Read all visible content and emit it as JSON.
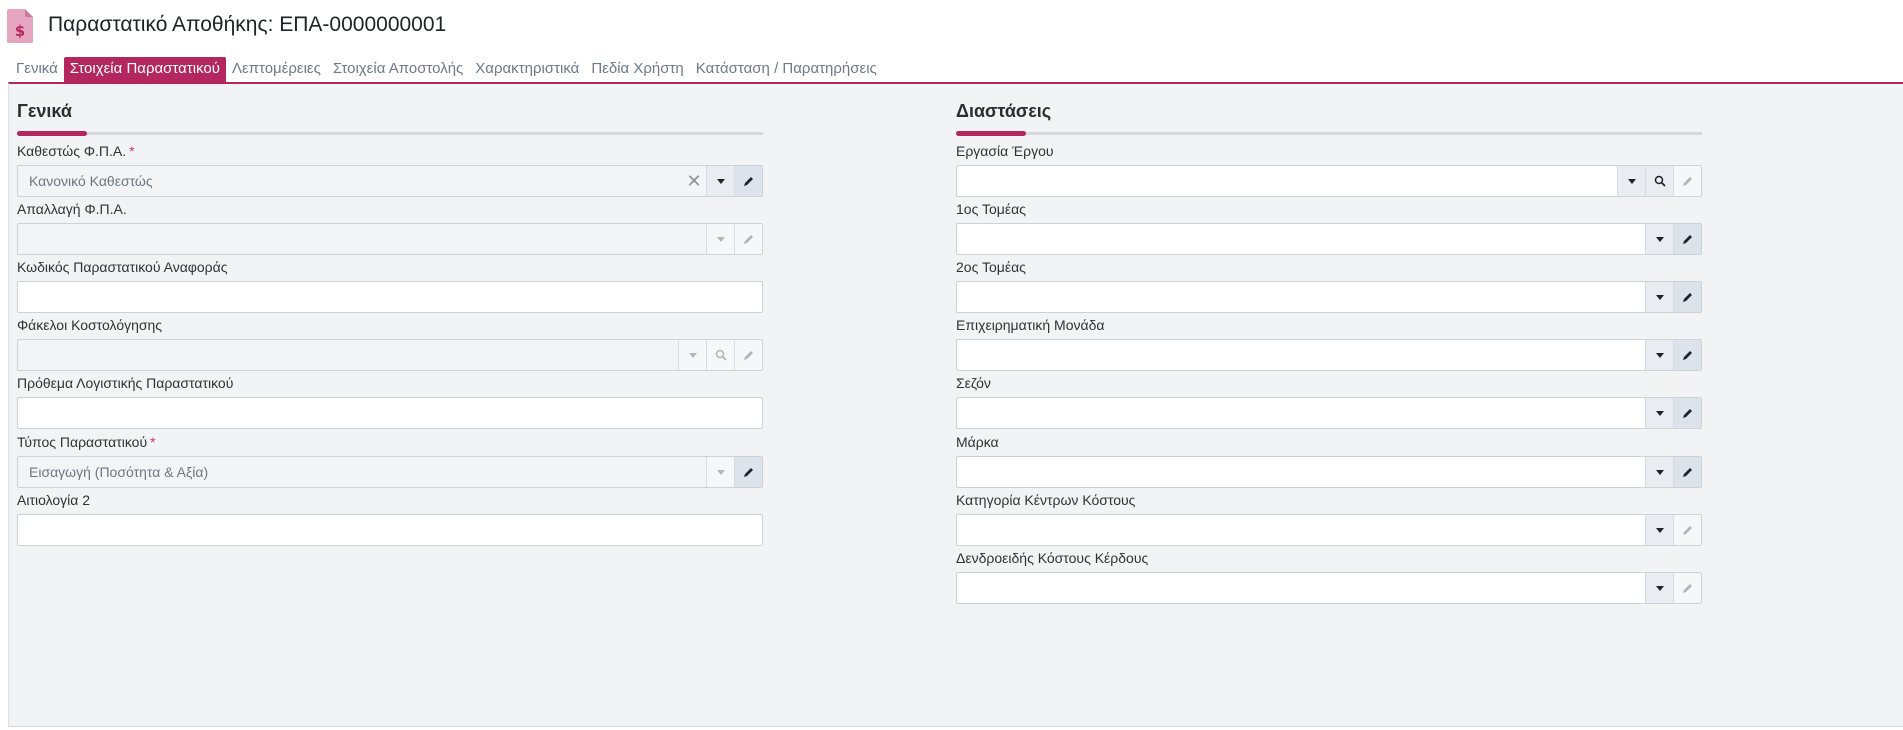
{
  "header": {
    "title": "Παραστατικό Αποθήκης: ΕΠΑ-0000000001",
    "icon": "invoice-dollar-icon"
  },
  "tabs": [
    {
      "label": "Γενικά",
      "active": false
    },
    {
      "label": "Στοιχεία Παραστατικού",
      "active": true
    },
    {
      "label": "Λεπτομέρειες",
      "active": false
    },
    {
      "label": "Στοιχεία Αποστολής",
      "active": false
    },
    {
      "label": "Χαρακτηριστικά",
      "active": false
    },
    {
      "label": "Πεδία Χρήστη",
      "active": false
    },
    {
      "label": "Κατάσταση / Παρατηρήσεις",
      "active": false
    }
  ],
  "general": {
    "title": "Γενικά",
    "vat_status": {
      "label": "Καθεστώς Φ.Π.Α.",
      "value": "Κανονικό Καθεστώς",
      "required": "*"
    },
    "vat_exemption": {
      "label": "Απαλλαγή Φ.Π.Α.",
      "value": ""
    },
    "reference_code": {
      "label": "Κωδικός Παραστατικού Αναφοράς",
      "value": ""
    },
    "costing_folders": {
      "label": "Φάκελοι Κοστολόγησης",
      "value": ""
    },
    "accounting_prefix": {
      "label": "Πρόθεμα Λογιστικής Παραστατικού",
      "value": ""
    },
    "document_type": {
      "label": "Τύπος Παραστατικού",
      "value": "Εισαγωγή (Ποσότητα & Αξία)",
      "required": "*"
    },
    "reason2": {
      "label": "Αιτιολογία 2",
      "value": ""
    }
  },
  "dimensions": {
    "title": "Διαστάσεις",
    "project_task": {
      "label": "Εργασία Έργου",
      "value": ""
    },
    "sector1": {
      "label": "1ος Τομέας",
      "value": ""
    },
    "sector2": {
      "label": "2ος Τομέας",
      "value": ""
    },
    "business_unit": {
      "label": "Επιχειρηματική Μονάδα",
      "value": ""
    },
    "season": {
      "label": "Σεζόν",
      "value": ""
    },
    "brand": {
      "label": "Μάρκα",
      "value": ""
    },
    "cost_center_category": {
      "label": "Κατηγορία Κέντρων Κόστους",
      "value": ""
    },
    "profit_cost_tree": {
      "label": "Δενδροειδής Κόστους Κέρδους",
      "value": ""
    }
  },
  "colors": {
    "accent": "#b3265e",
    "panel": "#f1f3f5"
  }
}
